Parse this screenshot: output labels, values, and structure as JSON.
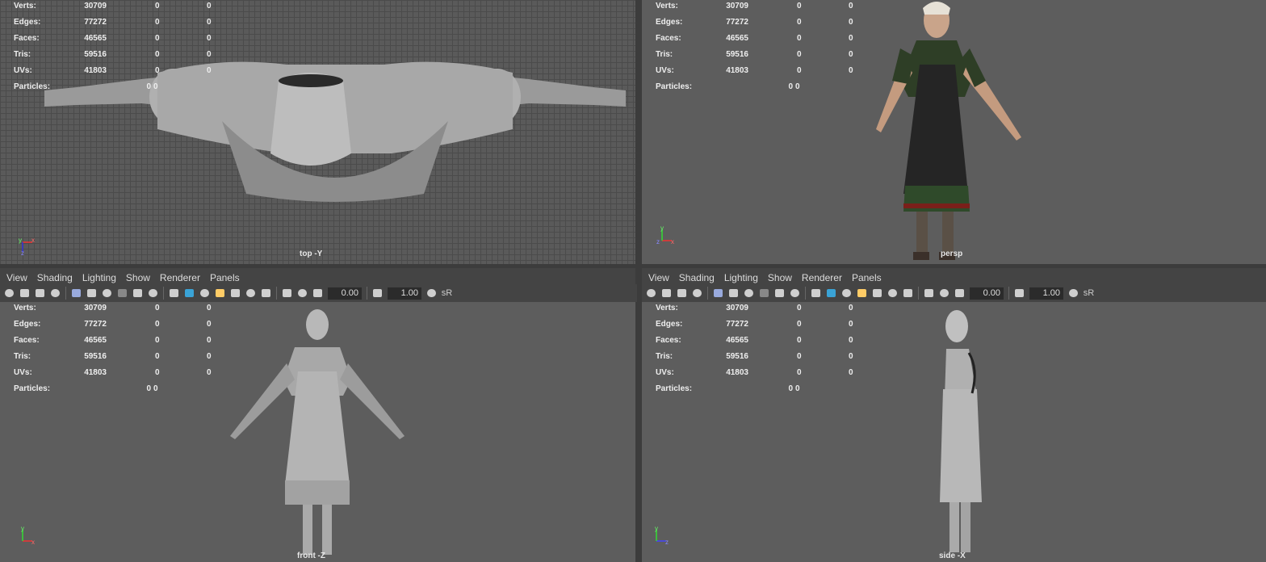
{
  "colors": {
    "viewport_bg": "#5d5d5d",
    "menu_bg": "#444444",
    "text": "#dddddd",
    "accent": "#3aa3d6"
  },
  "stats": {
    "verts_label": "Verts:",
    "verts": "30709",
    "edges_label": "Edges:",
    "edges": "77272",
    "faces_label": "Faces:",
    "faces": "46565",
    "tris_label": "Tris:",
    "tris": "59516",
    "uvs_label": "UVs:",
    "uvs": "41803",
    "particles_label": "Particles:",
    "zero": "0"
  },
  "menu": {
    "view": "View",
    "shading": "Shading",
    "lighting": "Lighting",
    "show": "Show",
    "renderer": "Renderer",
    "panels": "Panels"
  },
  "toolbar": {
    "field1": "0.00",
    "field2": "1.00",
    "srgb": "sR"
  },
  "viewports": {
    "top": {
      "label": "top -Y"
    },
    "persp": {
      "label": "persp"
    },
    "front": {
      "label": "front -Z"
    },
    "side": {
      "label": "side -X"
    }
  },
  "axis": {
    "x": "x",
    "y": "y",
    "z": "z"
  },
  "icons": [
    "camera-icon",
    "camera-attr-icon",
    "bookmark-icon",
    "image-plane-icon",
    "grid-icon",
    "film-gate-icon",
    "resolution-gate-icon",
    "gate-mask-icon",
    "field-chart-icon",
    "safe-action-icon",
    "wireframe-icon",
    "smooth-shade-icon",
    "textured-icon",
    "lights-icon",
    "shadows-icon",
    "ambient-occlusion-icon",
    "motion-blur-icon",
    "xray-icon",
    "isolate-icon",
    "exposure-icon",
    "gamma-icon",
    "color-mgmt-icon"
  ]
}
